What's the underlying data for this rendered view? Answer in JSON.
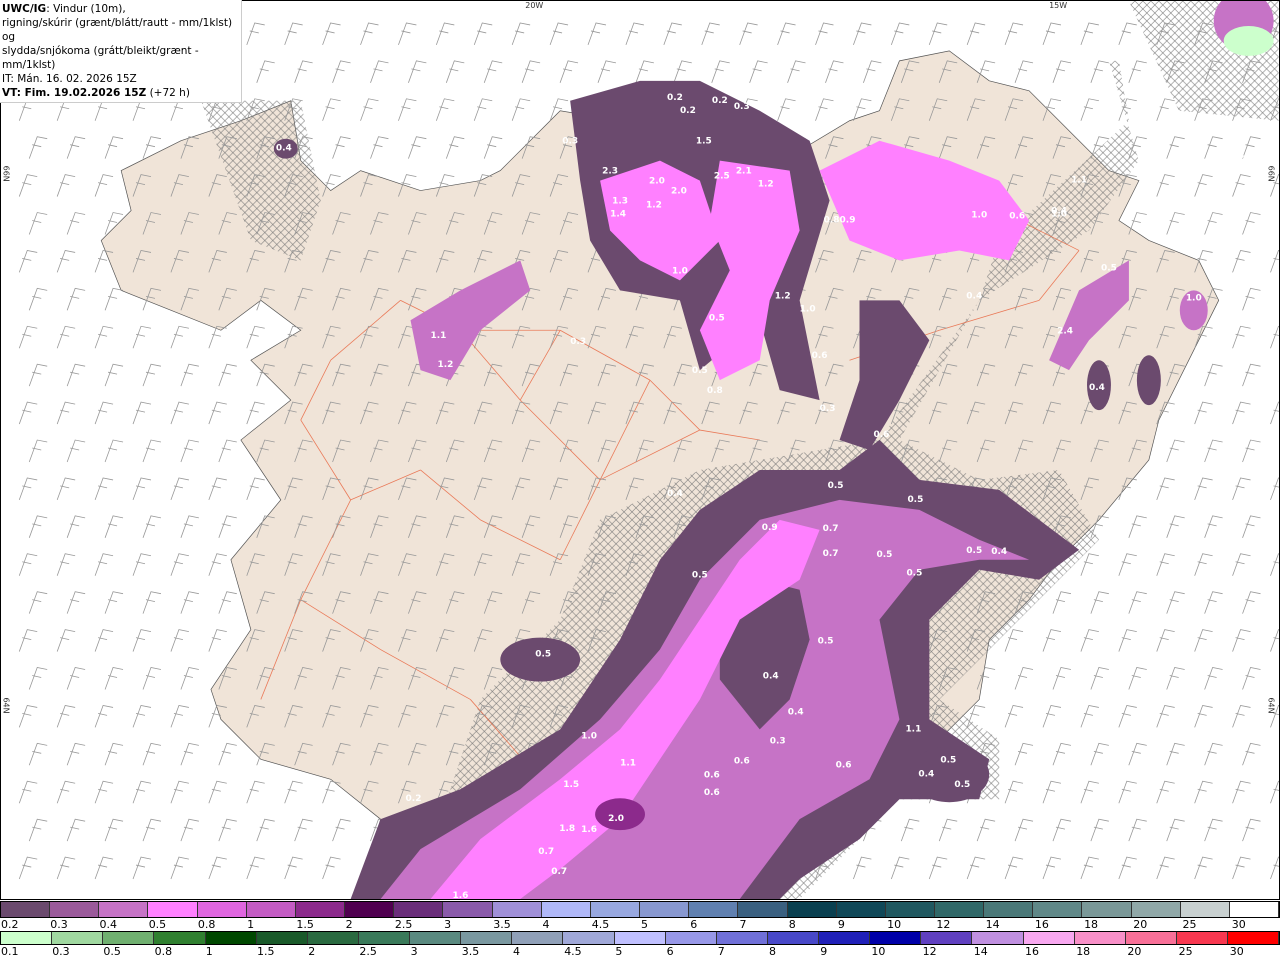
{
  "header": {
    "model": "UWC/IG",
    "line1_rest": ": Vindur (10m),",
    "line2": "rigning/skúrir (grænt/blátt/rautt - mm/1klst) og",
    "line3": "slydda/snjókoma (grátt/bleikt/grænt - mm/1klst)",
    "issue_time": "IT: Mán. 16. 02. 2026 15Z",
    "valid_time_bold": "VT: Fim. 19.02.2026 15Z",
    "valid_time_offset": " (+72 h)"
  },
  "map": {
    "land_color": "#f0e4d8",
    "sea_color": "#ffffff",
    "road_color": "#e8603a",
    "graticule_labels": [
      "20W",
      "15W",
      "66N",
      "64N",
      "66N",
      "64N"
    ],
    "precip_labels": [
      "0.4",
      "0.2",
      "0.2",
      "0.2",
      "0.3",
      "0.3",
      "1.5",
      "2.3",
      "2.0",
      "2.0",
      "2.5",
      "2.1",
      "1.2",
      "1.4",
      "1.3",
      "1.2",
      "1.0",
      "1.1",
      "1.0",
      "0.80.9",
      "1.2",
      "1.0",
      "0.6",
      "0.4",
      "0.5",
      "1.1",
      "1.2",
      "0.3",
      "0.5",
      "1.2",
      "1.0",
      "0.5",
      "0.8",
      "0.6",
      "0.3",
      "0.6",
      "2.4",
      "0.4",
      "0.4",
      "1.0",
      "0.4",
      "0.5",
      "0.9",
      "0.7",
      "0.7",
      "0.5",
      "0.5",
      "0.5",
      "0.5",
      "0.4",
      "0.5",
      "0.5",
      "0.4",
      "0.4",
      "0.3",
      "1.1",
      "0.5",
      "1.0",
      "1.1",
      "0.6",
      "0.6",
      "0.6",
      "1.5",
      "1.8",
      "1.6",
      "2.0",
      "0.7",
      "0.7",
      "1.6",
      "0.2",
      "0.4",
      "0.5",
      "0.5",
      "0.6"
    ]
  },
  "legend_snow": {
    "labels": [
      "0.2",
      "0.3",
      "0.4",
      "0.5",
      "0.8",
      "1",
      "1.5",
      "2",
      "2.5",
      "3",
      "3.5",
      "4",
      "4.5",
      "5",
      "6",
      "7",
      "8",
      "9",
      "10",
      "12",
      "14",
      "16",
      "18",
      "20",
      "25",
      "30"
    ],
    "colors": [
      "#6b4a6e",
      "#9b5a9b",
      "#c673c6",
      "#ff80ff",
      "#e066e0",
      "#c45cc4",
      "#8c2a8c",
      "#500050",
      "#6a2d7a",
      "#8a5aaa",
      "#a090d8",
      "#b0b8f8",
      "#98a8e0",
      "#8898d0",
      "#6080b0",
      "#3a6080",
      "#0a4050",
      "#104858",
      "#205860",
      "#306868",
      "#4a7878",
      "#608888",
      "#7a9898",
      "#90a8a8",
      "#c8d0d0",
      "#ffffff"
    ]
  },
  "legend_rain": {
    "labels": [
      "0.1",
      "0.3",
      "0.5",
      "0.8",
      "1",
      "1.5",
      "2",
      "2.5",
      "3",
      "3.5",
      "4",
      "4.5",
      "5",
      "6",
      "7",
      "8",
      "9",
      "10",
      "12",
      "14",
      "16",
      "18",
      "20",
      "25",
      "30"
    ],
    "colors": [
      "#ccffcc",
      "#a0d8a0",
      "#70b070",
      "#308030",
      "#004800",
      "#1a5a2a",
      "#2a6a40",
      "#3a7a5a",
      "#5a8a80",
      "#7a98a0",
      "#90a0b8",
      "#a0a8d8",
      "#c0c0ff",
      "#9898e8",
      "#7070d8",
      "#4848c8",
      "#2020b8",
      "#0000a8",
      "#6040c0",
      "#c090e0",
      "#f8a8f0",
      "#f890c8",
      "#f87098",
      "#f83850",
      "#ff0000"
    ]
  }
}
